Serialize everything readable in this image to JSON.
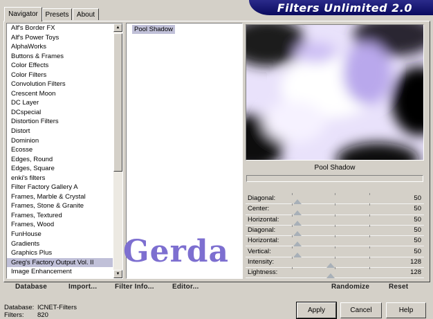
{
  "tabs": [
    {
      "label": "Navigator",
      "active": true
    },
    {
      "label": "Presets",
      "active": false
    },
    {
      "label": "About",
      "active": false
    }
  ],
  "app_title": "Filters Unlimited 2.0",
  "categories": [
    "Alf's Border FX",
    "Alf's Power Toys",
    "AlphaWorks",
    "Buttons & Frames",
    "Color Effects",
    "Color Filters",
    "Convolution Filters",
    "Crescent Moon",
    "DC Layer",
    "DCspecial",
    "Distortion Filters",
    "Distort",
    "Dominion",
    "Ecosse",
    "Edges, Round",
    "Edges, Square",
    "enki's filters",
    "Filter Factory Gallery A",
    "Frames, Marble & Crystal",
    "Frames, Stone & Granite",
    "Frames, Textured",
    "Frames, Wood",
    "FunHouse",
    "Gradients",
    "Graphics Plus",
    "Greg's Factory Output Vol. II",
    "Image Enhancement"
  ],
  "selected_category_index": 25,
  "filters": [
    "Pool Shadow"
  ],
  "preview_label": "Pool Shadow",
  "sliders": [
    {
      "label": "Diagonal:",
      "value": 50,
      "max": 255
    },
    {
      "label": "Center:",
      "value": 50,
      "max": 255
    },
    {
      "label": "Horizontal:",
      "value": 50,
      "max": 255
    },
    {
      "label": "Diagonal:",
      "value": 50,
      "max": 255
    },
    {
      "label": "Horizontal:",
      "value": 50,
      "max": 255
    },
    {
      "label": "Vertical:",
      "value": 50,
      "max": 255
    },
    {
      "label": "Intensity:",
      "value": 128,
      "max": 255
    },
    {
      "label": "Lightness:",
      "value": 128,
      "max": 255
    }
  ],
  "toolbar": {
    "database": "Database",
    "import": "Import...",
    "filter_info": "Filter Info...",
    "editor": "Editor...",
    "randomize": "Randomize",
    "reset": "Reset"
  },
  "watermark": "Gerda",
  "status": {
    "database_label": "Database:",
    "database_value": "ICNET-Filters",
    "filters_label": "Filters:",
    "filters_value": "820"
  },
  "buttons": {
    "apply": "Apply",
    "cancel": "Cancel",
    "help": "Help"
  },
  "colors": {
    "banner": "#0a0a5e",
    "selection": "#c0c0d8",
    "watermark": "#7d6fd0",
    "dialog": "#d4d0c8"
  }
}
